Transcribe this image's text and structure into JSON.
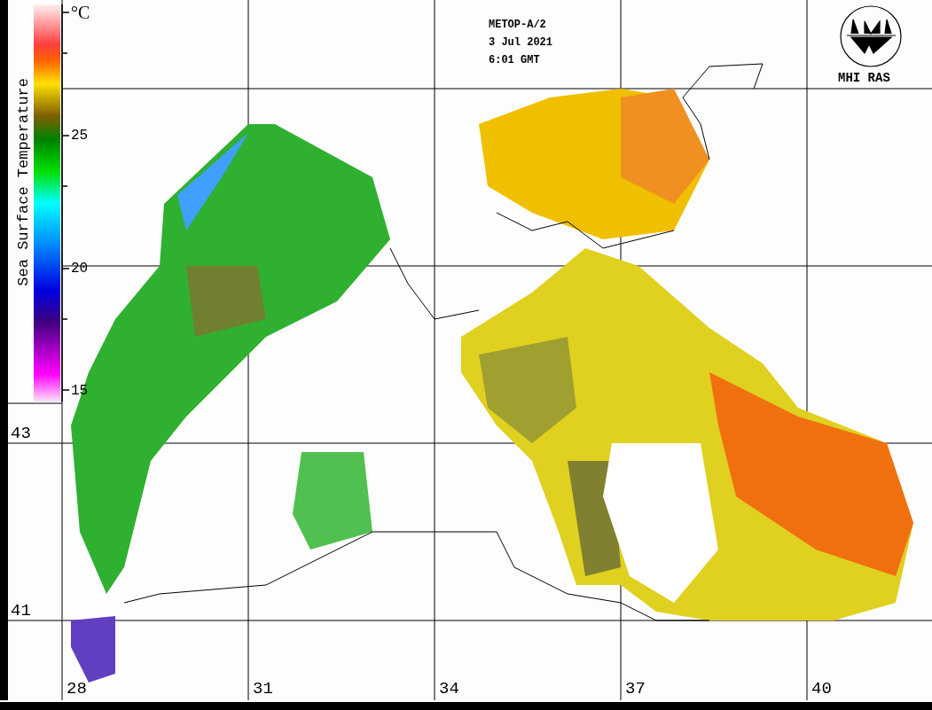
{
  "header": {
    "lines": [
      "METOP-A/2",
      "3 Jul 2021",
      "6:01 GMT"
    ]
  },
  "logo": {
    "text": "MHI RAS"
  },
  "colorbar": {
    "label": "Sea Surface Temperature",
    "unit": "°C",
    "ticks": [
      "25",
      "20",
      "15"
    ]
  },
  "latitudes": [
    "43",
    "41"
  ],
  "longitudes": [
    "28",
    "31",
    "34",
    "37",
    "40"
  ]
}
